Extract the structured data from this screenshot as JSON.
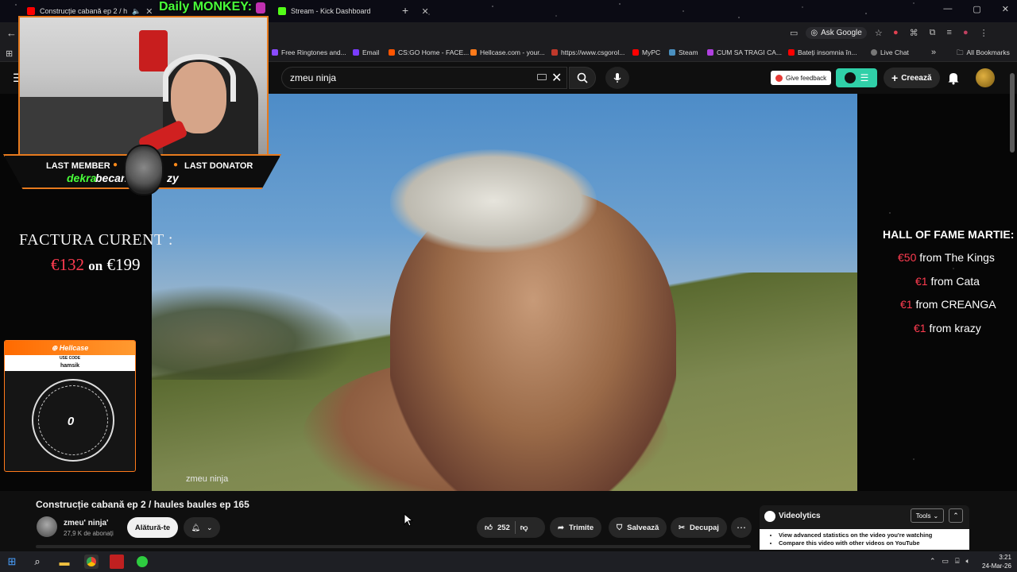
{
  "browser": {
    "tabs": [
      {
        "label": "Construcție cabană ep 2 / h",
        "color": "#ff0000"
      },
      {
        "label": "Stream - Kick Dashboard",
        "color": "#53fc18"
      }
    ],
    "new_tab": "+",
    "window_controls": [
      "—",
      "▢",
      "✕"
    ],
    "ask_google": "Ask Google"
  },
  "bookmarks": [
    {
      "label": "Free Ringtones and...",
      "color": "#8a4bff"
    },
    {
      "label": "Email",
      "color": "#7a3cff"
    },
    {
      "label": "CS:GO Home - FACE...",
      "color": "#ff5500"
    },
    {
      "label": "Hellcase.com - your...",
      "color": "#ff7a1a"
    },
    {
      "label": "https://www.csgorol...",
      "color": "#c0392b"
    },
    {
      "label": "MyPC",
      "color": "#ff0000"
    },
    {
      "label": "Steam",
      "color": "#4a90c0"
    },
    {
      "label": "CUM SA TRAGI CA...",
      "color": "#b040e0"
    },
    {
      "label": "Bateți insomnia în...",
      "color": "#ff0000"
    },
    {
      "label": "Live Chat",
      "color": "#777777"
    }
  ],
  "bookmarks_more": "»",
  "all_bookmarks": "All Bookmarks",
  "youtube": {
    "search_value": "zmeu ninja",
    "give_feedback": "Give feedback",
    "create_label": "Creează"
  },
  "overlay": {
    "daily_label": "Daily MONKEY:",
    "last_member_label": "LAST MEMBER",
    "last_member_value": "dekra",
    "last_donator_label": "LAST DONATOR",
    "last_donator_value": "becan",
    "last_donator_tail": "zy",
    "factura_title": "FACTURA CURENT :",
    "factura_current": "€132",
    "factura_on": "on",
    "factura_goal": "€199",
    "hellcase_brand": "Hellcase",
    "hellcase_use_code": "USE CODE",
    "hellcase_code": "hamsik",
    "hellcase_count": "0",
    "video_caption": "zmeu ninja",
    "hof_title": "HALL OF FAME MARTIE:",
    "hof": [
      {
        "amount": "€50",
        "text": "from The Kings"
      },
      {
        "amount": "€1",
        "text": "from Cata"
      },
      {
        "amount": "€1",
        "text": "from CREANGA"
      },
      {
        "amount": "€1",
        "text": "from krazy"
      }
    ]
  },
  "video": {
    "title": "Construcție cabană ep 2 / haules baules ep 165",
    "channel": "zmeu' ninja'",
    "subscribers": "27,9 K de abonați",
    "join": "Alătură-te",
    "likes": "252",
    "share": "Trimite",
    "save": "Salvează",
    "clip": "Decupaj",
    "more": "⋯"
  },
  "videolytics": {
    "title": "Videolytics",
    "tools": "Tools",
    "items": [
      "View advanced statistics on the video you're watching",
      "Compare this video with other videos on YouTube"
    ]
  },
  "taskbar": {
    "time": "3:21",
    "date": "24-Mar-26"
  }
}
